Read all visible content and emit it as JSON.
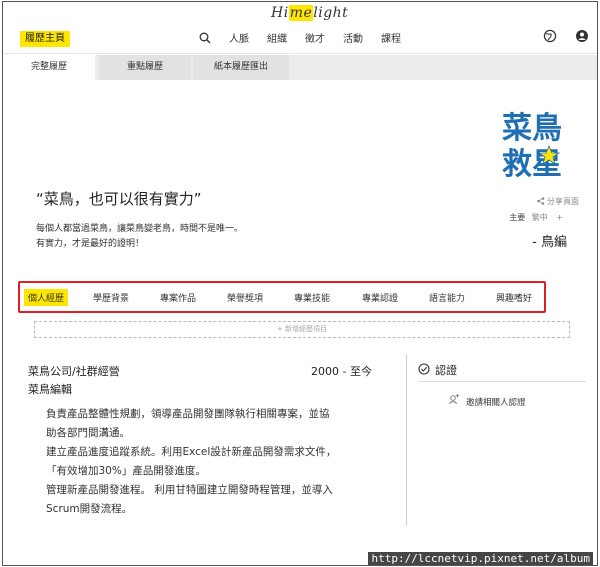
{
  "header": {
    "logo": {
      "pre": "Hi",
      "hl": "me",
      "post": "light"
    },
    "brand_tag": "履歷主頁",
    "nav": [
      "人脈",
      "組織",
      "徵才",
      "活動",
      "課程"
    ],
    "icons": [
      "search-icon",
      "globe-icon",
      "user-menu-icon"
    ]
  },
  "tabs": [
    "完整履歷",
    "重點履歷",
    "紙本履歷匯出"
  ],
  "profile": {
    "avatar_text": {
      "line1": "菜鳥",
      "line2": "救星"
    },
    "quote": "“菜鳥，也可以很有實力”",
    "bio": [
      "每個人都當過菜鳥，讓菜鳥變老鳥，時間不是唯一。",
      "有實力，才是最好的證明！"
    ],
    "share": "分享頁面",
    "lang_main": "主要",
    "lang_sub": "繁中",
    "lang_plus": "+",
    "nickname": "- 鳥編"
  },
  "section_tabs": [
    "個人經歷",
    "學歷背景",
    "專案作品",
    "榮譽獎項",
    "專業技能",
    "專業認證",
    "語言能力",
    "興趣嗜好"
  ],
  "add_item": "+ 新增經歷項目",
  "experience": {
    "company": "菜鳥公司/社群經營",
    "period": "2000 - 至今",
    "title": "菜鳥編輯",
    "desc": [
      "負責產品整體性規劃，領導產品開發團隊執行相關專案，並協",
      "助各部門間溝通。",
      "建立產品進度追蹤系統。利用Excel設計新產品開發需求文件，",
      "「有效增加30%」產品開發進度。",
      "管理新產品開發進程。 利用甘特圖建立開發時程管理，並導入",
      "Scrum開發流程。"
    ]
  },
  "certification": {
    "title": "認證",
    "invite": "邀請相關人認證"
  },
  "watermark": "http://lccnetvip.pixnet.net/album",
  "colors": {
    "accent": "#ffe600",
    "highlight_border": "#e02020",
    "avatar_blue": "#1f6fb5"
  }
}
